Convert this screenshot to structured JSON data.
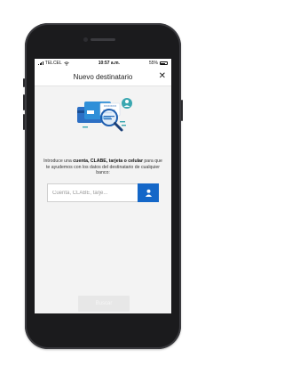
{
  "status_bar": {
    "carrier": "TELCEL",
    "time": "10:57 a.m.",
    "battery": "55%"
  },
  "header": {
    "title": "Nuevo destinatario",
    "close_icon": "close-icon"
  },
  "illustration": {
    "card_text": "XXXXXXXXX",
    "icon": "card-magnifier-illustration"
  },
  "instruction": {
    "prefix": "Introduce una",
    "bold": "cuenta, CLABE, tarjeta o celular",
    "suffix": "para que te ayudemos con los datos del destinatario de cualquier banco:"
  },
  "search": {
    "placeholder": "Cuenta, CLABE, tarje...",
    "value": "",
    "contact_icon": "person-icon"
  },
  "primary_button": {
    "label": "Buscar"
  },
  "colors": {
    "accent": "#1467c8",
    "teal": "#3aa7b0",
    "disabled": "#e7e7e7"
  }
}
